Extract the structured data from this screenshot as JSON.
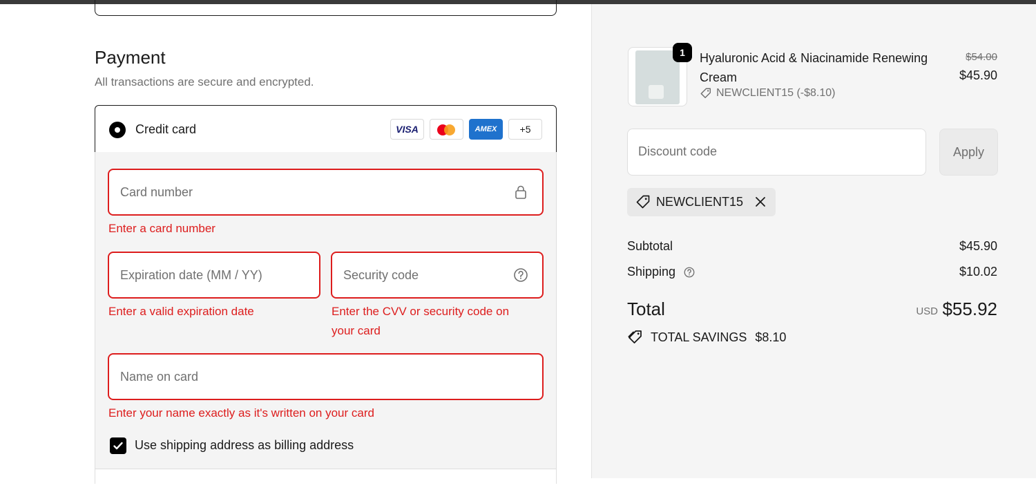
{
  "payment": {
    "title": "Payment",
    "subtitle": "All transactions are secure and encrypted.",
    "method_label": "Credit card",
    "brands": [
      "VISA",
      "Mastercard",
      "AMEX",
      "+5"
    ],
    "card_number": {
      "placeholder": "Card number",
      "error": "Enter a card number"
    },
    "expiration": {
      "placeholder": "Expiration date (MM / YY)",
      "error": "Enter a valid expiration date"
    },
    "security_code": {
      "placeholder": "Security code",
      "error_line1": "Enter the CVV or security code on",
      "error_line2": "your card"
    },
    "name_on_card": {
      "placeholder": "Name on card",
      "error": "Enter your name exactly as it's written on your card"
    },
    "billing_checkbox": {
      "label": "Use shipping address as billing address",
      "checked": true
    }
  },
  "summary": {
    "product": {
      "quantity": "1",
      "name": "Hyaluronic Acid & Niacinamide Renewing Cream",
      "discount_line": "NEWCLIENT15 (-$8.10)",
      "original_price": "$54.00",
      "price": "$45.90"
    },
    "discount_input": {
      "placeholder": "Discount code"
    },
    "apply_label": "Apply",
    "applied_code": "NEWCLIENT15",
    "subtotal_label": "Subtotal",
    "subtotal_value": "$45.90",
    "shipping_label": "Shipping",
    "shipping_value": "$10.02",
    "total_label": "Total",
    "currency": "USD",
    "total_value": "$55.92",
    "savings_label": "TOTAL SAVINGS",
    "savings_value": "$8.10"
  },
  "colors": {
    "error": "#dd1d1d",
    "summary_bg": "#f5f5f5",
    "amex": "#1f72cd"
  }
}
